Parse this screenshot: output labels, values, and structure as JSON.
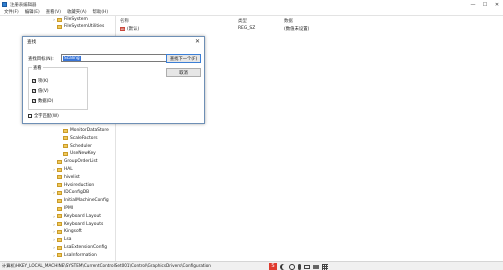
{
  "window": {
    "title": "注册表编辑器",
    "min_glyph": "—",
    "max_glyph": "☐",
    "close_glyph": "✕"
  },
  "menu": [
    "文件(F)",
    "编辑(E)",
    "查看(V)",
    "收藏夹(A)",
    "帮助(H)"
  ],
  "tree": {
    "items_top": [
      {
        "label": "FileSystem",
        "expandable": true
      },
      {
        "label": "FileSystemUtilities",
        "expandable": false
      }
    ],
    "items_bottom": [
      {
        "label": "MonitorDataStore",
        "expandable": false
      },
      {
        "label": "ScaleFactors",
        "expandable": false
      },
      {
        "label": "Scheduler",
        "expandable": false
      },
      {
        "label": "UseNewKey",
        "expandable": false
      },
      {
        "label": "GroupOrderList",
        "expandable": false
      },
      {
        "label": "HAL",
        "expandable": true
      },
      {
        "label": "hivelist",
        "expandable": false
      },
      {
        "label": "Hvsireduction",
        "expandable": false
      },
      {
        "label": "IDConfigDB",
        "expandable": true
      },
      {
        "label": "InitialMachineConfig",
        "expandable": false
      },
      {
        "label": "IPMI",
        "expandable": false
      },
      {
        "label": "Keyboard Layout",
        "expandable": true
      },
      {
        "label": "Keyboard Layouts",
        "expandable": true
      },
      {
        "label": "Kingsoft",
        "expandable": true
      },
      {
        "label": "Lsa",
        "expandable": true
      },
      {
        "label": "LsaExtensionConfig",
        "expandable": true
      },
      {
        "label": "LsaInformation",
        "expandable": true
      }
    ]
  },
  "list": {
    "headers": {
      "name": "名称",
      "type": "类型",
      "data": "数据"
    },
    "rows": [
      {
        "name": "(默认)",
        "type": "REG_SZ",
        "data": "(数值未设置)"
      }
    ]
  },
  "status": {
    "path": "计算机\\HKEY_LOCAL_MACHINE\\SYSTEM\\CurrentControlSet001\\Control\\GraphicsDrivers\\Configuration",
    "tray_s": "S"
  },
  "dialog": {
    "title": "查找",
    "close_glyph": "✕",
    "find_label": "查找目标(N):",
    "find_value": "Scaling",
    "find_next_button": "查找下一个(F)",
    "cancel_button": "取消",
    "lookin_legend": "查看",
    "options": [
      {
        "label": "项(K)",
        "checked": true
      },
      {
        "label": "值(V)",
        "checked": true
      },
      {
        "label": "数据(D)",
        "checked": true
      }
    ],
    "whole_string": {
      "label": "全字匹配(W)",
      "checked": false
    }
  },
  "colors": {
    "selection": "#3a76d8",
    "folder": "#f1c95a",
    "dialog_border": "#6e8fb5",
    "tray_s": "#e03a2e"
  }
}
